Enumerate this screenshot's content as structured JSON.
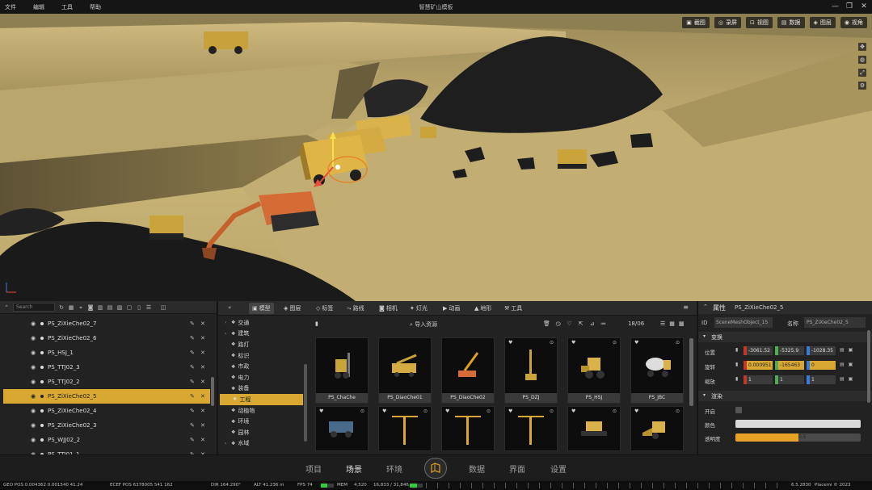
{
  "window": {
    "menu": [
      "文件",
      "编辑",
      "工具",
      "帮助"
    ],
    "title": "智慧矿山模板"
  },
  "viewport": {
    "toolbar": [
      {
        "icon": "camera-icon",
        "label": "截图"
      },
      {
        "icon": "record-icon",
        "label": "录屏"
      },
      {
        "icon": "view-icon",
        "label": "视图"
      },
      {
        "icon": "dataview-icon",
        "label": "数据"
      },
      {
        "icon": "layer-icon",
        "label": "图层"
      },
      {
        "icon": "eye-icon",
        "label": "视角"
      }
    ],
    "side_tools": [
      "move-icon",
      "globe-icon",
      "expand-icon",
      "settings-icon"
    ]
  },
  "outliner": {
    "search_placeholder": "Search",
    "items": [
      {
        "name": "PS_ZiXieChe02_7",
        "selected": false
      },
      {
        "name": "PS_ZiXieChe02_6",
        "selected": false
      },
      {
        "name": "PS_HSJ_1",
        "selected": false
      },
      {
        "name": "PS_TTJ02_3",
        "selected": false
      },
      {
        "name": "PS_TTJ02_2",
        "selected": false
      },
      {
        "name": "PS_ZiXieChe02_5",
        "selected": true
      },
      {
        "name": "PS_ZiXieChe02_4",
        "selected": false
      },
      {
        "name": "PS_ZiXieChe02_3",
        "selected": false
      },
      {
        "name": "PS_WJJ02_2",
        "selected": false
      },
      {
        "name": "PS_TTJ01_1",
        "selected": false
      }
    ]
  },
  "assets": {
    "tabs": [
      {
        "label": "模型",
        "active": true
      },
      {
        "label": "图层",
        "active": false
      },
      {
        "label": "标签",
        "active": false
      },
      {
        "label": "路线",
        "active": false
      },
      {
        "label": "相机",
        "active": false
      },
      {
        "label": "灯光",
        "active": false
      },
      {
        "label": "动画",
        "active": false
      },
      {
        "label": "地形",
        "active": false
      },
      {
        "label": "工具",
        "active": false
      }
    ],
    "categories": [
      {
        "label": "交通",
        "expandable": true,
        "selected": false
      },
      {
        "label": "建筑",
        "expandable": true,
        "selected": false
      },
      {
        "label": "路灯",
        "expandable": false,
        "selected": false
      },
      {
        "label": "标识",
        "expandable": false,
        "selected": false
      },
      {
        "label": "市政",
        "expandable": false,
        "selected": false
      },
      {
        "label": "电力",
        "expandable": false,
        "selected": false
      },
      {
        "label": "装备",
        "expandable": false,
        "selected": false
      },
      {
        "label": "工程",
        "expandable": false,
        "selected": true
      },
      {
        "label": "动植物",
        "expandable": false,
        "selected": false
      },
      {
        "label": "环境",
        "expandable": false,
        "selected": false
      },
      {
        "label": "园林",
        "expandable": false,
        "selected": false
      },
      {
        "label": "水域",
        "expandable": true,
        "selected": false
      }
    ],
    "import_label": "导入资源",
    "count": "18/06",
    "tiles": [
      {
        "label": "PS_ChaChe",
        "icon": "forklift-icon"
      },
      {
        "label": "PS_DiaoChe01",
        "icon": "truck-crane-icon"
      },
      {
        "label": "PS_DiaoChe02",
        "icon": "crane-icon"
      },
      {
        "label": "PS_DZJ",
        "icon": "drill-rig-icon"
      },
      {
        "label": "PS_HSJ",
        "icon": "wheel-loader-icon"
      },
      {
        "label": "PS_JBC",
        "icon": "mixer-truck-icon"
      },
      {
        "label": "",
        "icon": "armored-truck-icon"
      },
      {
        "label": "",
        "icon": "tower-crane-icon"
      },
      {
        "label": "",
        "icon": "tower-crane-icon"
      },
      {
        "label": "",
        "icon": "tower-crane-icon"
      },
      {
        "label": "",
        "icon": "bulldozer-icon"
      },
      {
        "label": "",
        "icon": "loader-icon"
      }
    ]
  },
  "properties": {
    "title": "属性",
    "object": "PS_ZiXieChe02_5",
    "id_label": "ID",
    "id_value": "SceneMeshObject_15",
    "name_label": "名称",
    "name_value": "PS_ZiXieChe02_5",
    "transform_title": "变换",
    "transform": [
      {
        "label": "位置",
        "x": "-3061.52",
        "y": "-5325.9",
        "z": "-1028.35",
        "hl": false
      },
      {
        "label": "旋转",
        "x": "0.000951",
        "y": "-165463",
        "z": "0",
        "hl": true
      },
      {
        "label": "缩放",
        "x": "1",
        "y": "1",
        "z": "1",
        "hl": false
      }
    ],
    "render_title": "渲染",
    "render": {
      "visible_label": "开启",
      "color_label": "颜色",
      "opacity_label": "透明度",
      "opacity_value": "0.5",
      "opacity_fraction": 0.5
    },
    "colors": {
      "x": "#c0392b",
      "y": "#4caf50",
      "z": "#3a7bd5"
    }
  },
  "bottom_nav": [
    {
      "label": "项目",
      "active": false
    },
    {
      "label": "场景",
      "active": true
    },
    {
      "label": "环境",
      "active": false
    },
    {
      "label": "数据",
      "active": false
    },
    {
      "label": "界面",
      "active": false
    },
    {
      "label": "设置",
      "active": false
    }
  ],
  "status": {
    "geo_pos": "GEO POS  0.004362  0.001540  41.24",
    "ecef_pos": "ECEF POS  6378005  541  162",
    "dir": "DIR  164.290°",
    "alt": "ALT  41.236 m",
    "fps": "FPS  74",
    "fps_fraction": 0.5,
    "mem_label": "MEM",
    "mem": "4,520",
    "gpu": "16,833 / 31,846",
    "gpu_fraction": 0.55,
    "version": "6.5.2830",
    "copyright": "Placemi © 2023"
  }
}
